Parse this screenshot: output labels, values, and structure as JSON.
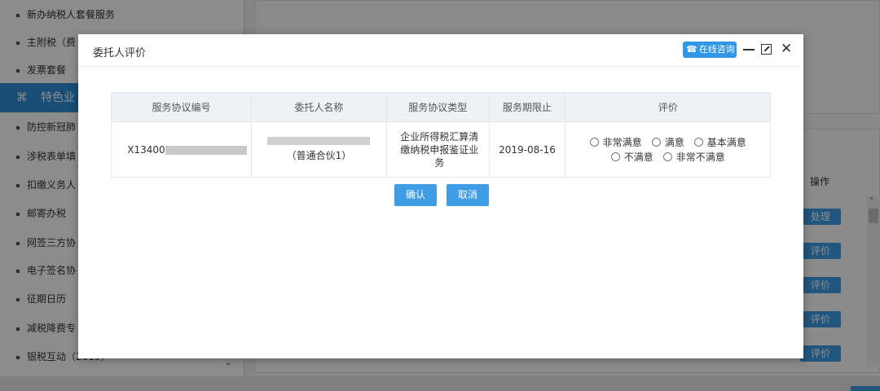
{
  "sidebar": {
    "items": [
      {
        "label": "新办纳税人套餐服务"
      },
      {
        "label": "主附税（费"
      },
      {
        "label": "发票套餐"
      },
      {
        "label": "特色业"
      },
      {
        "label": "防控新冠肺"
      },
      {
        "label": "涉税表单填"
      },
      {
        "label": "扣缴义务人"
      },
      {
        "label": "邮寄办税"
      },
      {
        "label": "网签三方协"
      },
      {
        "label": "电子签名协"
      },
      {
        "label": "征期日历"
      },
      {
        "label": "减税降费专"
      },
      {
        "label": "银税互动（2019）"
      }
    ],
    "active_index": 3,
    "active_icon": "apps-grid-icon"
  },
  "background_table": {
    "operation_header": "操作",
    "row_buttons": [
      "处理",
      "评价",
      "评价",
      "评价",
      "评价"
    ]
  },
  "modal": {
    "title": "委托人评价",
    "consult_label": "在线咨询",
    "consult_icon": "headset-icon",
    "columns": [
      "服务协议编号",
      "委托人名称",
      "服务协议类型",
      "服务期限止",
      "评价"
    ],
    "rows": [
      {
        "agreement_id": "X13400",
        "client_suffix": "（普通合伙1）",
        "service_type": "企业所得税汇算清缴纳税申报鉴证业务",
        "end_date": "2019-08-16",
        "rating_options": [
          "非常满意",
          "满意",
          "基本满意",
          "不满意",
          "非常不满意"
        ]
      }
    ],
    "confirm_label": "确认",
    "cancel_label": "取消"
  },
  "colors": {
    "accent": "#2f8fd9",
    "button": "#3f9de6",
    "header_bg": "#eef1f5"
  }
}
